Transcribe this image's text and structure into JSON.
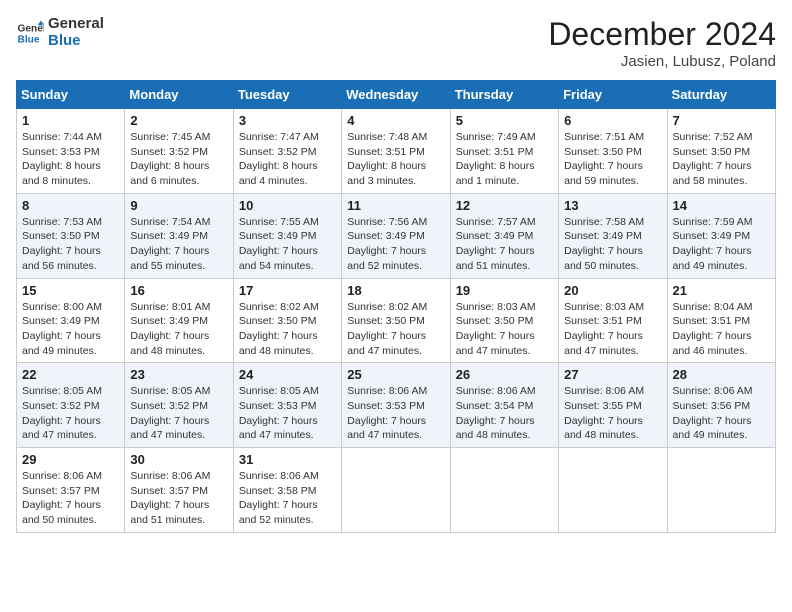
{
  "logo": {
    "line1": "General",
    "line2": "Blue"
  },
  "title": "December 2024",
  "location": "Jasien, Lubusz, Poland",
  "weekdays": [
    "Sunday",
    "Monday",
    "Tuesday",
    "Wednesday",
    "Thursday",
    "Friday",
    "Saturday"
  ],
  "weeks": [
    [
      {
        "day": "1",
        "info": "Sunrise: 7:44 AM\nSunset: 3:53 PM\nDaylight: 8 hours\nand 8 minutes."
      },
      {
        "day": "2",
        "info": "Sunrise: 7:45 AM\nSunset: 3:52 PM\nDaylight: 8 hours\nand 6 minutes."
      },
      {
        "day": "3",
        "info": "Sunrise: 7:47 AM\nSunset: 3:52 PM\nDaylight: 8 hours\nand 4 minutes."
      },
      {
        "day": "4",
        "info": "Sunrise: 7:48 AM\nSunset: 3:51 PM\nDaylight: 8 hours\nand 3 minutes."
      },
      {
        "day": "5",
        "info": "Sunrise: 7:49 AM\nSunset: 3:51 PM\nDaylight: 8 hours\nand 1 minute."
      },
      {
        "day": "6",
        "info": "Sunrise: 7:51 AM\nSunset: 3:50 PM\nDaylight: 7 hours\nand 59 minutes."
      },
      {
        "day": "7",
        "info": "Sunrise: 7:52 AM\nSunset: 3:50 PM\nDaylight: 7 hours\nand 58 minutes."
      }
    ],
    [
      {
        "day": "8",
        "info": "Sunrise: 7:53 AM\nSunset: 3:50 PM\nDaylight: 7 hours\nand 56 minutes."
      },
      {
        "day": "9",
        "info": "Sunrise: 7:54 AM\nSunset: 3:49 PM\nDaylight: 7 hours\nand 55 minutes."
      },
      {
        "day": "10",
        "info": "Sunrise: 7:55 AM\nSunset: 3:49 PM\nDaylight: 7 hours\nand 54 minutes."
      },
      {
        "day": "11",
        "info": "Sunrise: 7:56 AM\nSunset: 3:49 PM\nDaylight: 7 hours\nand 52 minutes."
      },
      {
        "day": "12",
        "info": "Sunrise: 7:57 AM\nSunset: 3:49 PM\nDaylight: 7 hours\nand 51 minutes."
      },
      {
        "day": "13",
        "info": "Sunrise: 7:58 AM\nSunset: 3:49 PM\nDaylight: 7 hours\nand 50 minutes."
      },
      {
        "day": "14",
        "info": "Sunrise: 7:59 AM\nSunset: 3:49 PM\nDaylight: 7 hours\nand 49 minutes."
      }
    ],
    [
      {
        "day": "15",
        "info": "Sunrise: 8:00 AM\nSunset: 3:49 PM\nDaylight: 7 hours\nand 49 minutes."
      },
      {
        "day": "16",
        "info": "Sunrise: 8:01 AM\nSunset: 3:49 PM\nDaylight: 7 hours\nand 48 minutes."
      },
      {
        "day": "17",
        "info": "Sunrise: 8:02 AM\nSunset: 3:50 PM\nDaylight: 7 hours\nand 48 minutes."
      },
      {
        "day": "18",
        "info": "Sunrise: 8:02 AM\nSunset: 3:50 PM\nDaylight: 7 hours\nand 47 minutes."
      },
      {
        "day": "19",
        "info": "Sunrise: 8:03 AM\nSunset: 3:50 PM\nDaylight: 7 hours\nand 47 minutes."
      },
      {
        "day": "20",
        "info": "Sunrise: 8:03 AM\nSunset: 3:51 PM\nDaylight: 7 hours\nand 47 minutes."
      },
      {
        "day": "21",
        "info": "Sunrise: 8:04 AM\nSunset: 3:51 PM\nDaylight: 7 hours\nand 46 minutes."
      }
    ],
    [
      {
        "day": "22",
        "info": "Sunrise: 8:05 AM\nSunset: 3:52 PM\nDaylight: 7 hours\nand 47 minutes."
      },
      {
        "day": "23",
        "info": "Sunrise: 8:05 AM\nSunset: 3:52 PM\nDaylight: 7 hours\nand 47 minutes."
      },
      {
        "day": "24",
        "info": "Sunrise: 8:05 AM\nSunset: 3:53 PM\nDaylight: 7 hours\nand 47 minutes."
      },
      {
        "day": "25",
        "info": "Sunrise: 8:06 AM\nSunset: 3:53 PM\nDaylight: 7 hours\nand 47 minutes."
      },
      {
        "day": "26",
        "info": "Sunrise: 8:06 AM\nSunset: 3:54 PM\nDaylight: 7 hours\nand 48 minutes."
      },
      {
        "day": "27",
        "info": "Sunrise: 8:06 AM\nSunset: 3:55 PM\nDaylight: 7 hours\nand 48 minutes."
      },
      {
        "day": "28",
        "info": "Sunrise: 8:06 AM\nSunset: 3:56 PM\nDaylight: 7 hours\nand 49 minutes."
      }
    ],
    [
      {
        "day": "29",
        "info": "Sunrise: 8:06 AM\nSunset: 3:57 PM\nDaylight: 7 hours\nand 50 minutes."
      },
      {
        "day": "30",
        "info": "Sunrise: 8:06 AM\nSunset: 3:57 PM\nDaylight: 7 hours\nand 51 minutes."
      },
      {
        "day": "31",
        "info": "Sunrise: 8:06 AM\nSunset: 3:58 PM\nDaylight: 7 hours\nand 52 minutes."
      },
      {
        "day": "",
        "info": ""
      },
      {
        "day": "",
        "info": ""
      },
      {
        "day": "",
        "info": ""
      },
      {
        "day": "",
        "info": ""
      }
    ]
  ]
}
